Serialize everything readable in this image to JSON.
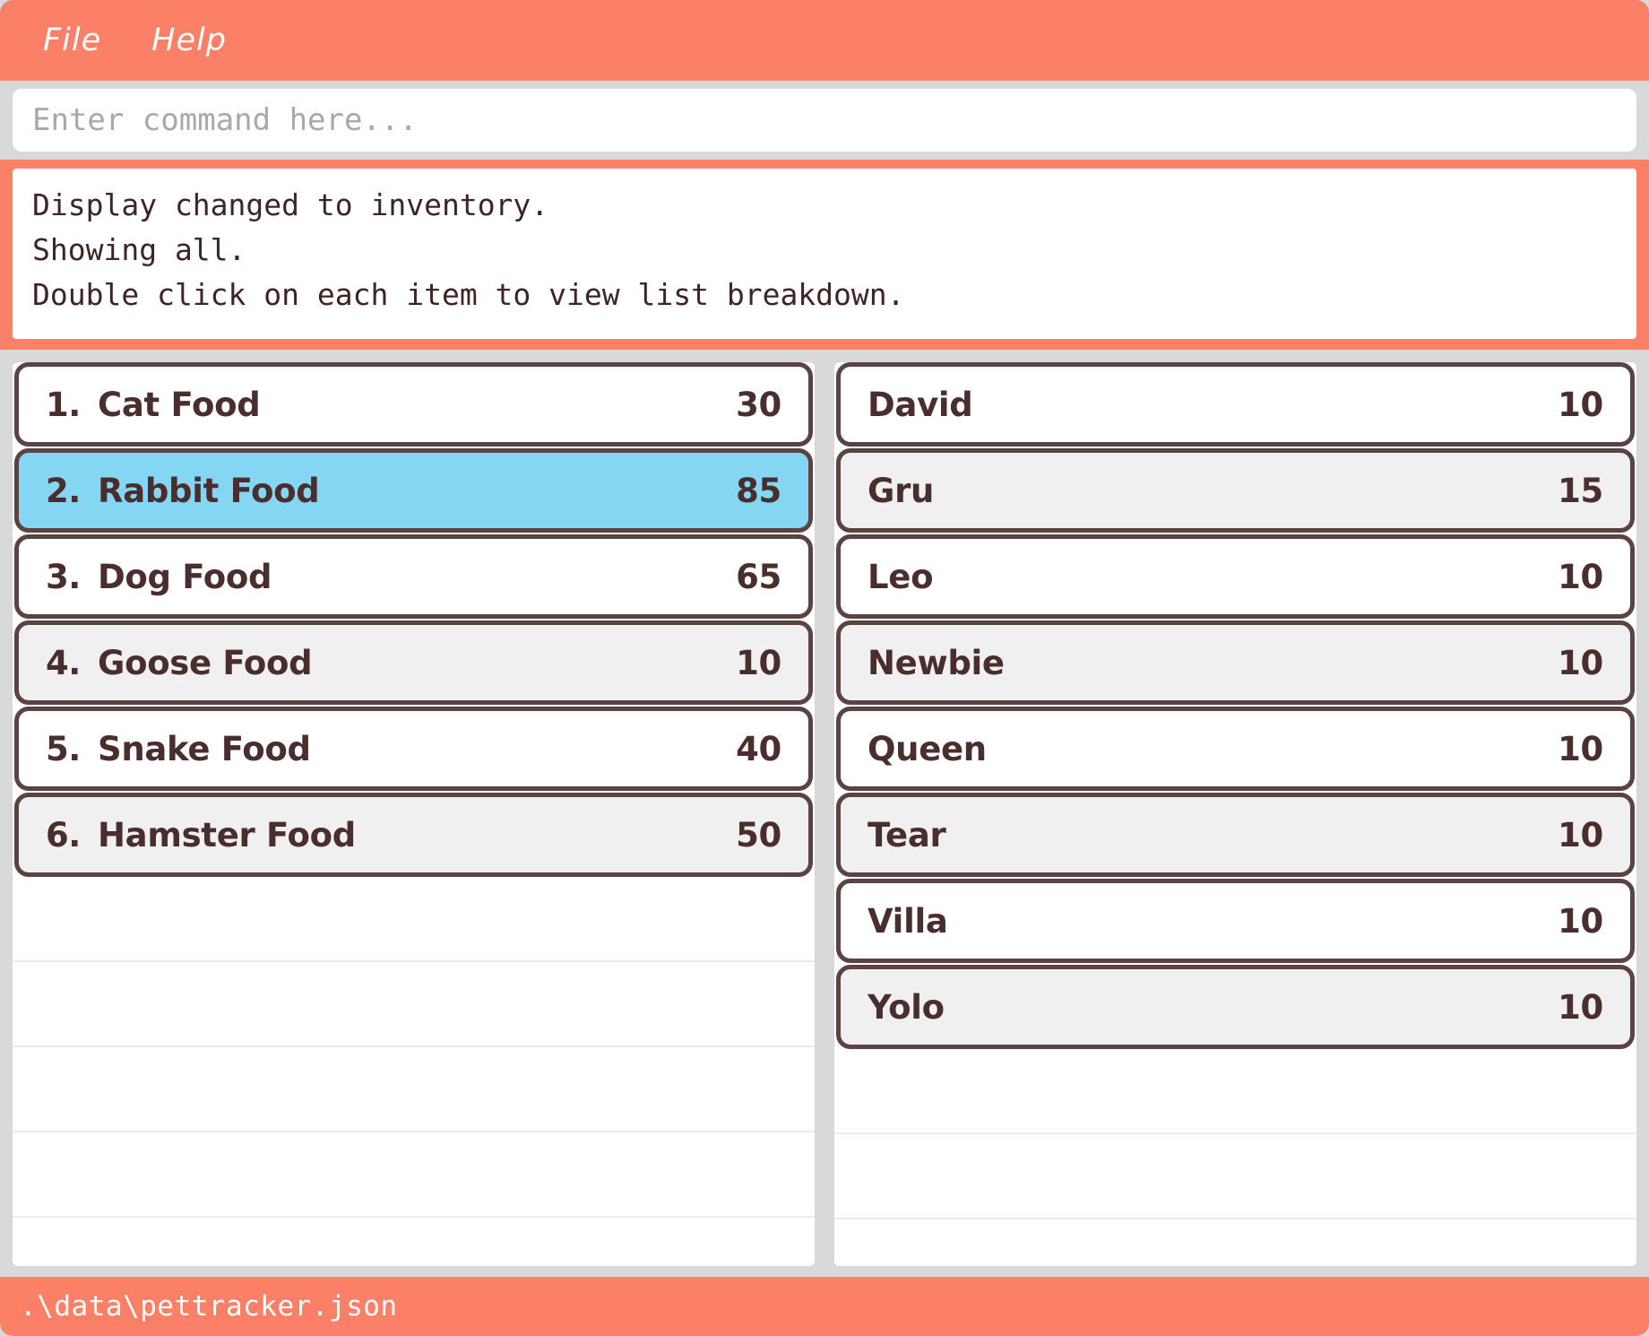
{
  "menu": {
    "items": [
      {
        "label": "File",
        "name": "menu-file"
      },
      {
        "label": "Help",
        "name": "menu-help"
      }
    ]
  },
  "command": {
    "placeholder": "Enter command here...",
    "value": ""
  },
  "console": {
    "lines": [
      "Display changed to inventory.",
      "Showing all.",
      "Double click on each item to view list breakdown."
    ],
    "text": "Display changed to inventory.\nShowing all.\nDouble click on each item to view list breakdown."
  },
  "inventory_list": {
    "rows": [
      {
        "index": "1.",
        "label": "Cat Food",
        "value": "30",
        "selected": false
      },
      {
        "index": "2.",
        "label": "Rabbit Food",
        "value": "85",
        "selected": true
      },
      {
        "index": "3.",
        "label": "Dog Food",
        "value": "65",
        "selected": false
      },
      {
        "index": "4.",
        "label": "Goose Food",
        "value": "10",
        "selected": false
      },
      {
        "index": "5.",
        "label": "Snake Food",
        "value": "40",
        "selected": false
      },
      {
        "index": "6.",
        "label": "Hamster Food",
        "value": "50",
        "selected": false
      }
    ]
  },
  "breakdown_list": {
    "rows": [
      {
        "index": "",
        "label": "David",
        "value": "10",
        "selected": false
      },
      {
        "index": "",
        "label": "Gru",
        "value": "15",
        "selected": false
      },
      {
        "index": "",
        "label": "Leo",
        "value": "10",
        "selected": false
      },
      {
        "index": "",
        "label": "Newbie",
        "value": "10",
        "selected": false
      },
      {
        "index": "",
        "label": "Queen",
        "value": "10",
        "selected": false
      },
      {
        "index": "",
        "label": "Tear",
        "value": "10",
        "selected": false
      },
      {
        "index": "",
        "label": "Villa",
        "value": "10",
        "selected": false
      },
      {
        "index": "",
        "label": "Yolo",
        "value": "10",
        "selected": false
      }
    ]
  },
  "status": {
    "path": ".\\data\\pettracker.json"
  },
  "colors": {
    "accent": "#fc8068",
    "window_bg": "#d9d9d9",
    "row_border": "#5b4343",
    "row_bg": "#ffffff",
    "row_bg_alt": "#f1f0f0",
    "row_selected": "#84d6f2",
    "text": "#4a2d2d",
    "placeholder": "#a8a8a8"
  }
}
